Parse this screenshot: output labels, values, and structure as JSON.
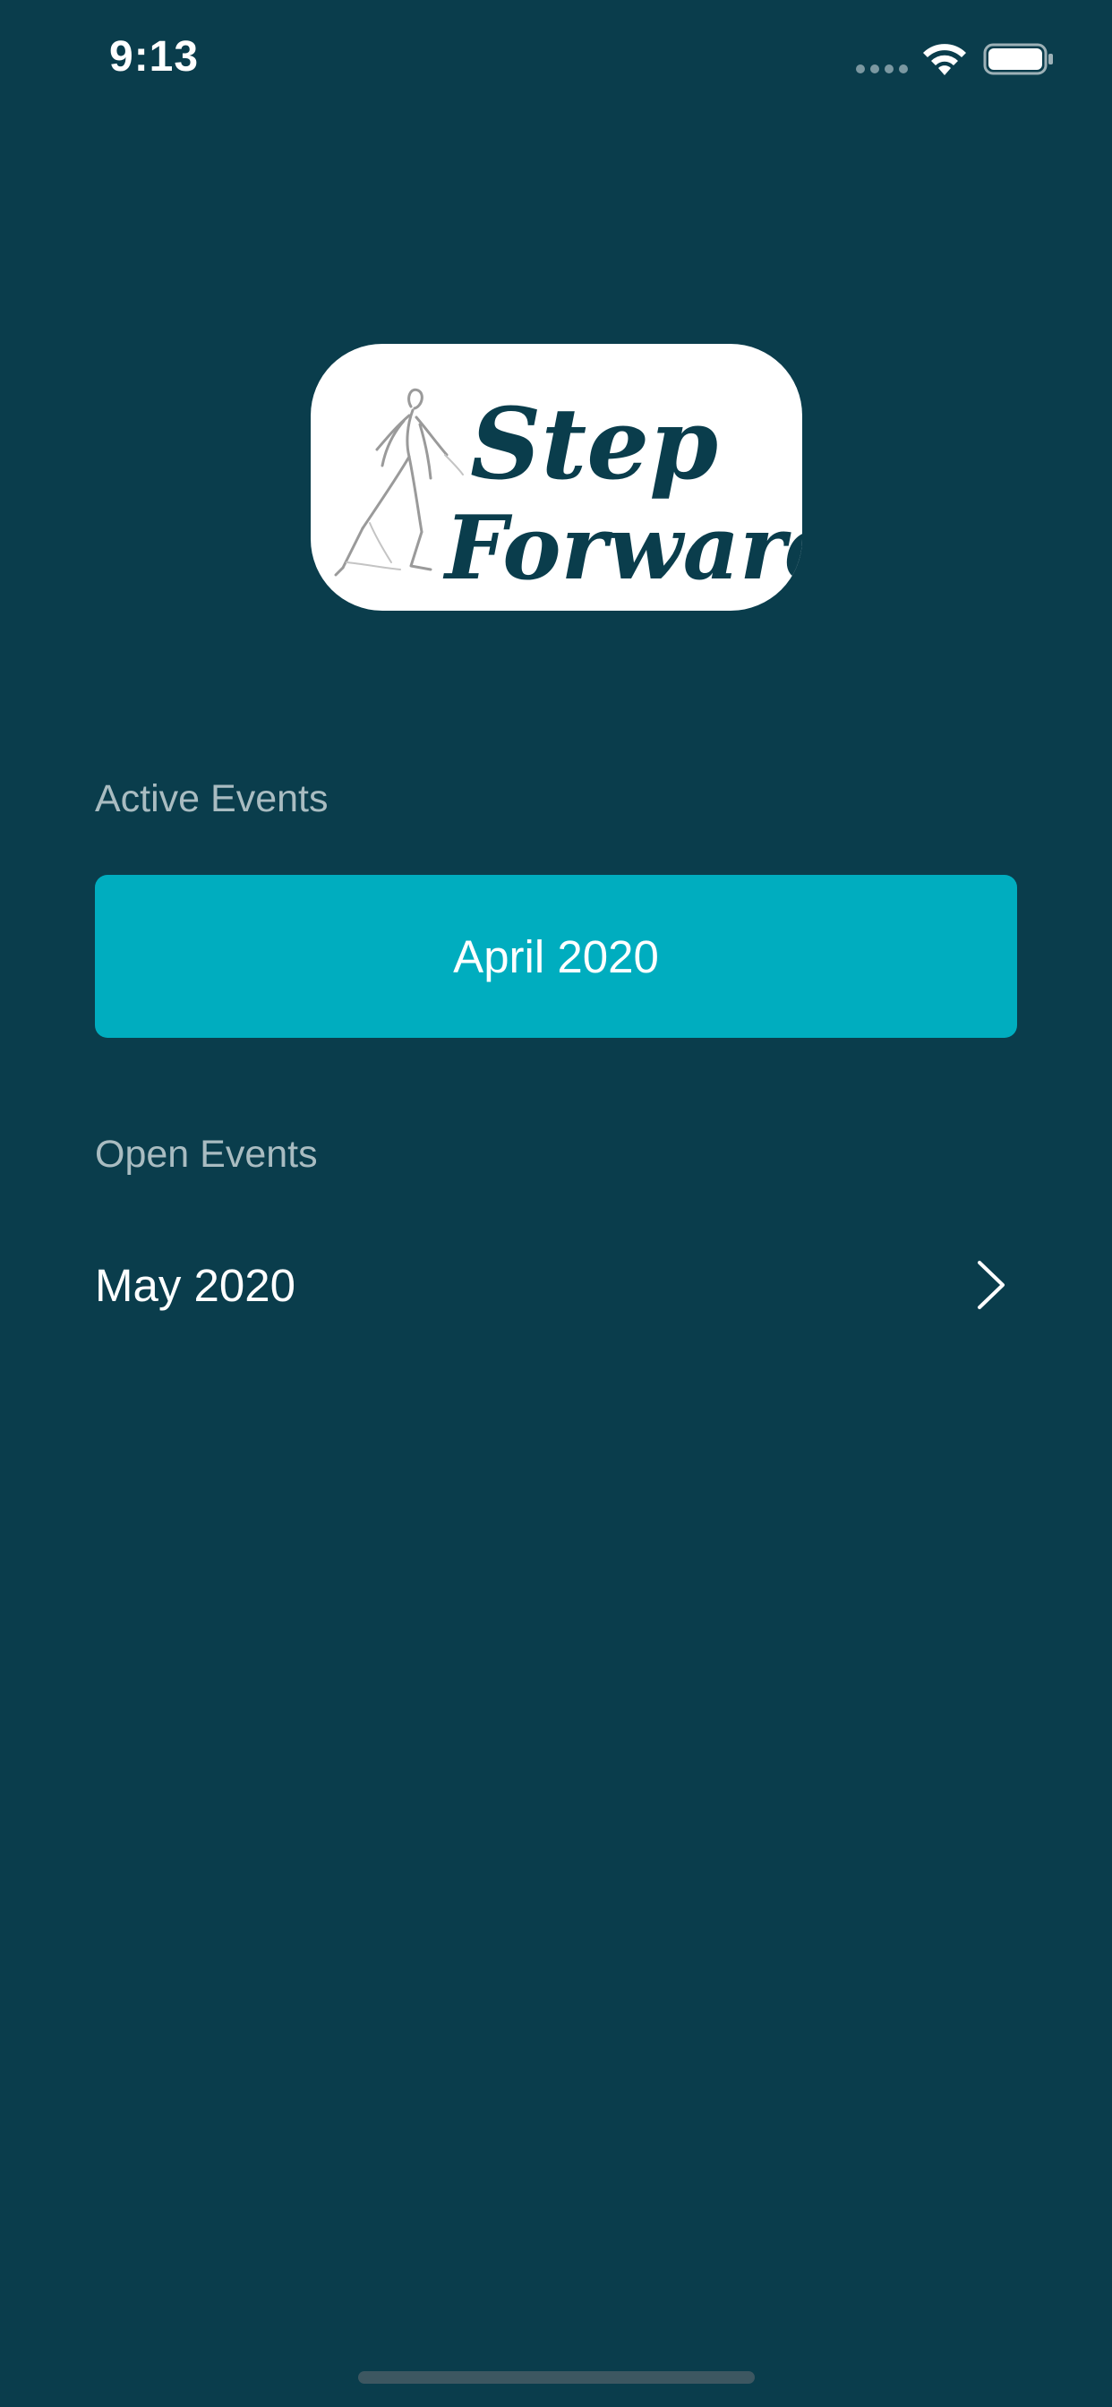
{
  "status_bar": {
    "time": "9:13",
    "signal_icon": "cellular-signal-icon",
    "wifi_icon": "wifi-icon",
    "battery_icon": "battery-icon"
  },
  "logo": {
    "text_line1": "Step",
    "text_line2": "Forward",
    "icon": "walking-person-icon"
  },
  "active_events": {
    "heading": "Active Events",
    "items": [
      {
        "label": "April 2020"
      }
    ]
  },
  "open_events": {
    "heading": "Open Events",
    "items": [
      {
        "label": "May 2020",
        "icon": "chevron-right-icon"
      }
    ]
  },
  "colors": {
    "background": "#0a3d4c",
    "accent": "#00adbf",
    "label_gray": "#a9bcc1",
    "logo_text": "#0a3d4c",
    "white": "#ffffff"
  }
}
